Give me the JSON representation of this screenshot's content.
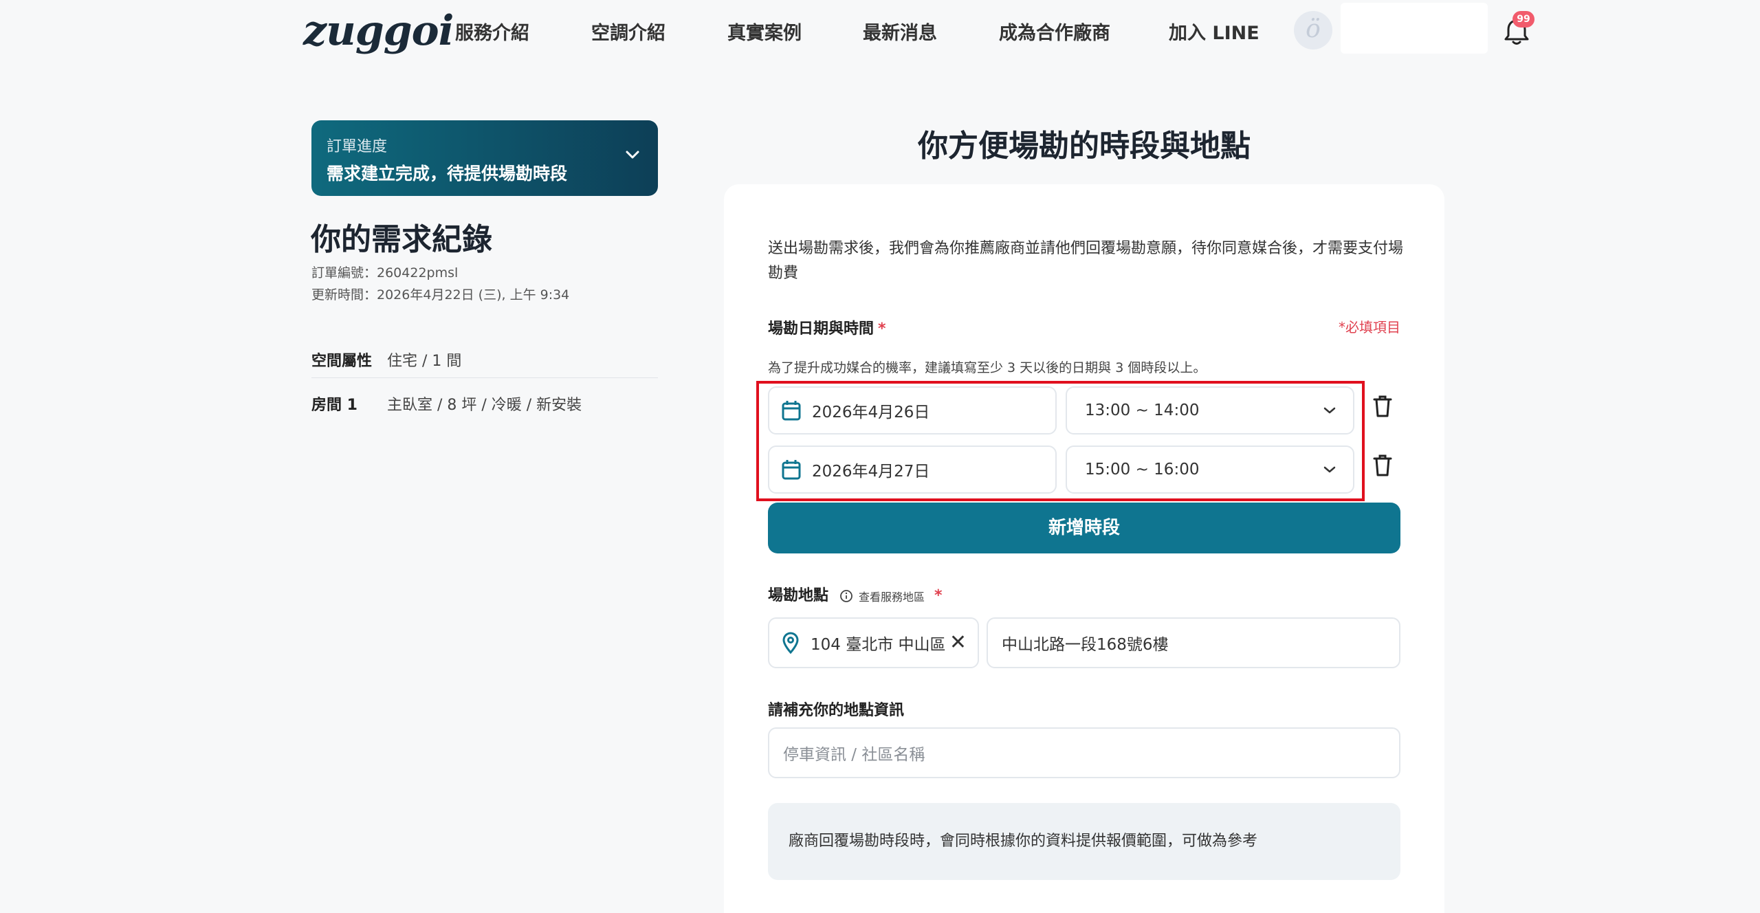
{
  "header": {
    "logo": "zuggoi",
    "nav": [
      "服務介紹",
      "空調介紹",
      "真實案例",
      "最新消息",
      "成為合作廠商",
      "加入 LINE"
    ],
    "avatar_glyph": "ö",
    "notification_count": "99",
    "icons": [
      "avatar-icon",
      "bell-icon"
    ]
  },
  "sidebar": {
    "progress": {
      "label": "訂單進度",
      "status": "需求建立完成，待提供場勘時段"
    },
    "record_title": "你的需求紀錄",
    "order_number": "訂單編號：260422pmsl",
    "updated_at": "更新時間：2026年4月22日 (三), 上午 9:34",
    "attributes": [
      {
        "key": "空間屬性",
        "value": "住宅 / 1 間"
      },
      {
        "key": "房間 1",
        "value": "主臥室 / 8 坪 / 冷暖 / 新安裝"
      }
    ]
  },
  "form": {
    "title": "你方便場勘的時段與地點",
    "intro": "送出場勘需求後，我們會為你推薦廠商並請他們回覆場勘意願，待你同意媒合後，才需要支付場勘費",
    "schedule": {
      "label": "場勘日期與時間",
      "required_mark": "*",
      "required_note": "*必填項目",
      "hint": "為了提升成功媒合的機率，建議填寫至少 3 天以後的日期與 3 個時段以上。",
      "slots": [
        {
          "date": "2026年4月26日",
          "time": "13:00 ~ 14:00"
        },
        {
          "date": "2026年4月27日",
          "time": "15:00 ~ 16:00"
        }
      ],
      "add_button": "新增時段"
    },
    "location": {
      "label": "場勘地點",
      "info_link": "查看服務地區",
      "required_mark": "*",
      "district": "104 臺北市 中山區",
      "clear_glyph": "✕",
      "address": "中山北路一段168號6樓"
    },
    "extra": {
      "label": "請補充你的地點資訊",
      "placeholder": "停車資訊 / 社區名稱"
    },
    "note": "廠商回覆場勘時段時，會同時根據你的資料提供報價範圍，可做為參考"
  },
  "colors": {
    "accent": "#0f7590",
    "progress_gradient_start": "#0f6a7e",
    "progress_gradient_end": "#0d3f57",
    "required": "#e0414f",
    "highlight_border": "#e0101e",
    "badge": "#f15b6c"
  }
}
